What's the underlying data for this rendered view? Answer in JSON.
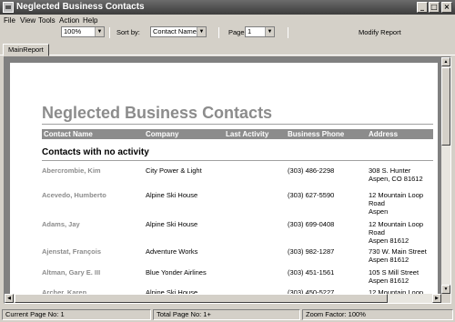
{
  "window": {
    "title": "Neglected Business Contacts"
  },
  "menu": [
    "File",
    "View",
    "Tools",
    "Action",
    "Help"
  ],
  "toolbar": {
    "zoom_value": "100%",
    "sort_label": "Sort by:",
    "sort_value": "Contact Name",
    "page_label": "Page:",
    "page_value": "1",
    "modify_label": "Modify Report"
  },
  "tabs": [
    "MainReport"
  ],
  "report": {
    "title": "Neglected Business Contacts",
    "columns": [
      "Contact Name",
      "Company",
      "Last Activity",
      "Business Phone",
      "Address"
    ],
    "section_title": "Contacts with no activity",
    "rows": [
      {
        "name": "Abercrombie, Kim",
        "company": "City Power & Light",
        "last_activity": "",
        "phone": "(303) 486-2298",
        "address": "308 S. Hunter\nAspen, CO 81612"
      },
      {
        "name": "Acevedo, Humberto",
        "company": "Alpine Ski House",
        "last_activity": "",
        "phone": "(303) 627-5590",
        "address": "12 Mountain Loop\nRoad\nAspen"
      },
      {
        "name": "Adams, Jay",
        "company": "Alpine Ski House",
        "last_activity": "",
        "phone": "(303) 699-0408",
        "address": "12 Mountain Loop\nRoad\nAspen 81612"
      },
      {
        "name": "Ajenstat, François",
        "company": "Adventure Works",
        "last_activity": "",
        "phone": "(303) 982-1287",
        "address": "730 W. Main Street\nAspen 81612"
      },
      {
        "name": "Altman, Gary E. III",
        "company": "Blue Yonder Airlines",
        "last_activity": "",
        "phone": "(303) 451-1561",
        "address": "105 S Mill Street\nAspen 81612"
      },
      {
        "name": "Archer, Karen",
        "company": "Alpine Ski House",
        "last_activity": "",
        "phone": "(303) 450-5227",
        "address": "12 Mountain Loop"
      }
    ]
  },
  "status": {
    "current_page": "Current Page No: 1",
    "total_page": "Total Page No: 1+",
    "zoom": "Zoom Factor: 100%"
  }
}
